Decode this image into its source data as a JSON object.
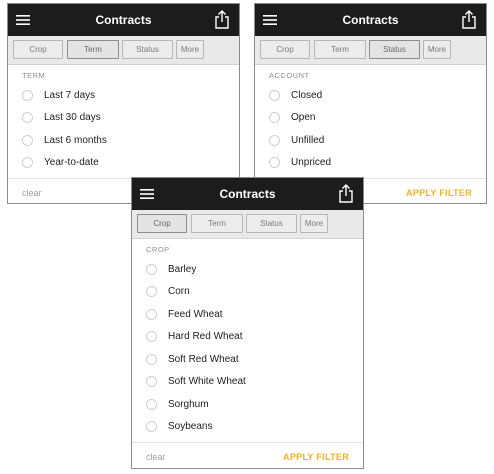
{
  "colors": {
    "header": "#1c1c1c",
    "accent": "#f0b421"
  },
  "icons": {
    "menu": "hamburger-menu-icon",
    "share": "share-icon",
    "radio": "radio-unchecked-icon"
  },
  "tabs": [
    "Crop",
    "Term",
    "Status",
    "More"
  ],
  "footer": {
    "clear": "clear",
    "apply": "APPLY FILTER"
  },
  "panels": {
    "term": {
      "title": "Contracts",
      "active_tab": "Term",
      "section": "TERM",
      "options": [
        "Last 7 days",
        "Last 30 days",
        "Last 6 months",
        "Year-to-date"
      ]
    },
    "status": {
      "title": "Contracts",
      "active_tab": "Status",
      "section": "ACCOUNT",
      "options": [
        "Closed",
        "Open",
        "Unfilled",
        "Unpriced"
      ]
    },
    "crop": {
      "title": "Contracts",
      "active_tab": "Crop",
      "section": "CROP",
      "options": [
        "Barley",
        "Corn",
        "Feed Wheat",
        "Hard Red Wheat",
        "Soft Red Wheat",
        "Soft White Wheat",
        "Sorghum",
        "Soybeans"
      ]
    }
  }
}
